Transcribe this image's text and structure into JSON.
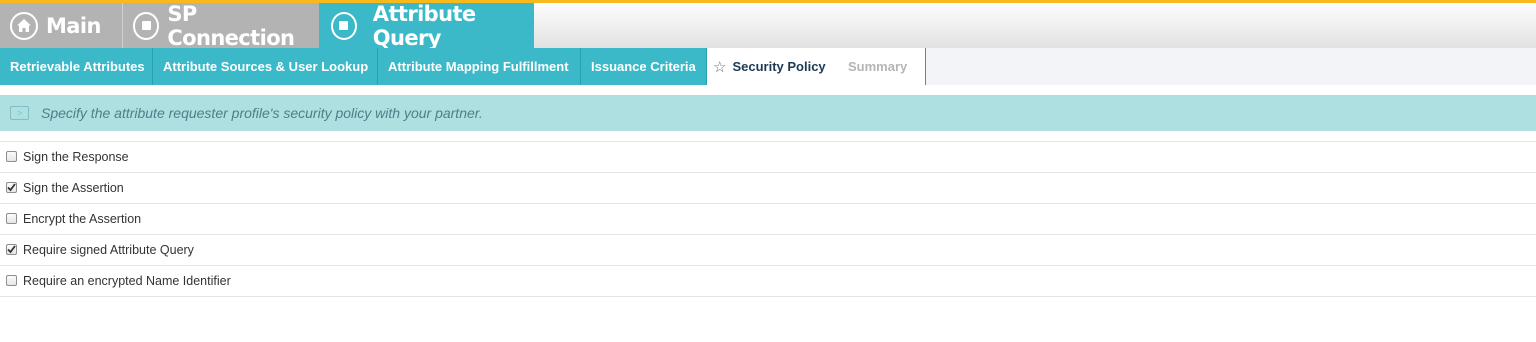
{
  "breadcrumb": [
    {
      "label": "Main",
      "icon": "home-icon"
    },
    {
      "label": "SP Connection",
      "icon": "stop-icon"
    },
    {
      "label": "Attribute Query",
      "icon": "stop-icon"
    }
  ],
  "subtabs": [
    {
      "label": "Retrievable Attributes"
    },
    {
      "label": "Attribute Sources & User Lookup"
    },
    {
      "label": "Attribute Mapping Fulfillment"
    },
    {
      "label": "Issuance Criteria"
    },
    {
      "label": "Security Policy",
      "icon": "star-icon",
      "state": "active"
    },
    {
      "label": "Summary",
      "state": "disabled"
    }
  ],
  "banner": {
    "icon": "info-panel-icon",
    "text": "Specify the attribute requester profile's security policy with your partner."
  },
  "options": [
    {
      "label": "Sign the Response",
      "checked": false
    },
    {
      "label": "Sign the Assertion",
      "checked": true
    },
    {
      "label": "Encrypt the Assertion",
      "checked": false
    },
    {
      "label": "Require signed Attribute Query",
      "checked": true
    },
    {
      "label": "Require an encrypted Name Identifier",
      "checked": false
    }
  ],
  "colors": {
    "accent": "#f7b91b",
    "teal": "#3bb9c9",
    "inactive_crumb": "#b3b3b3",
    "banner": "#aee0e2"
  }
}
